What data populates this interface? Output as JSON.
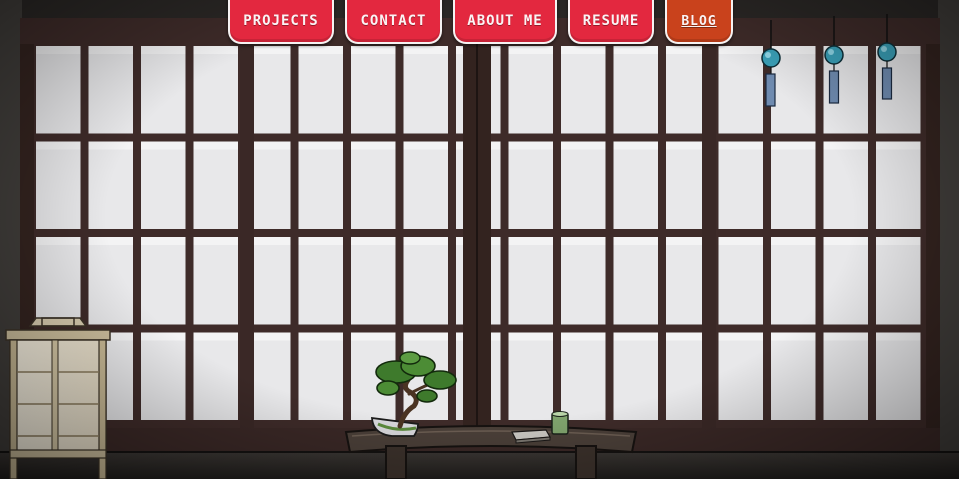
{
  "nav": {
    "items": [
      {
        "label": "PROJECTS"
      },
      {
        "label": "CONTACT"
      },
      {
        "label": "ABOUT ME"
      },
      {
        "label": "RESUME"
      },
      {
        "label": "BLOG"
      }
    ],
    "active_color": "#c9421c",
    "color": "#e3283f"
  },
  "icons": [
    "wind-chime-icon",
    "bonsai-tree-icon",
    "paper-lantern-icon",
    "tea-cup-icon",
    "book-icon"
  ],
  "colors": {
    "frame": "#3e2b29",
    "paper": "#e8e8ea",
    "floor": "#2b2826"
  }
}
